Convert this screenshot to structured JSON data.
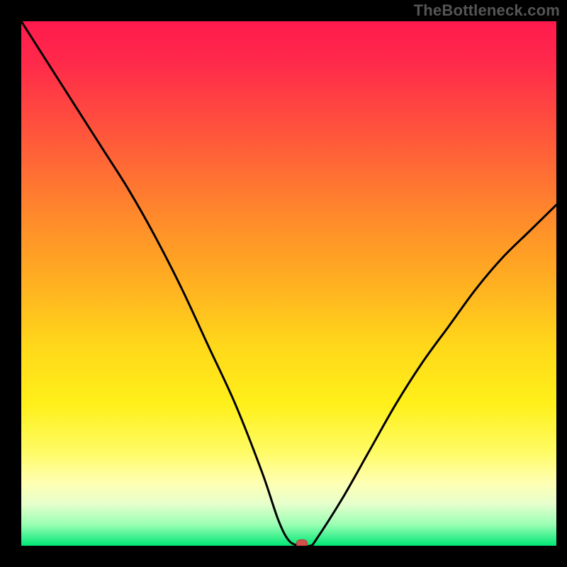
{
  "watermark": "TheBottleneck.com",
  "colors": {
    "border": "#000000",
    "curve": "#000000",
    "marker": "#d1504a",
    "gradient_top": "#ff1a4d",
    "gradient_bottom": "#00e676"
  },
  "chart_data": {
    "type": "line",
    "title": "",
    "xlabel": "",
    "ylabel": "",
    "xlim": [
      0,
      100
    ],
    "ylim": [
      0,
      100
    ],
    "grid": false,
    "legend": false,
    "series": [
      {
        "name": "bottleneck-curve",
        "x": [
          0,
          5,
          10,
          15,
          20,
          25,
          30,
          35,
          40,
          45,
          48,
          50,
          52,
          54,
          55,
          60,
          65,
          70,
          75,
          80,
          85,
          90,
          95,
          100
        ],
        "y": [
          100,
          92,
          84,
          76,
          68,
          59,
          49,
          38,
          27,
          14,
          5,
          1,
          0,
          0,
          1,
          9,
          18,
          27,
          35,
          42,
          49,
          55,
          60,
          65
        ]
      }
    ],
    "marker": {
      "x": 52.5,
      "y": 0
    },
    "annotations": []
  }
}
